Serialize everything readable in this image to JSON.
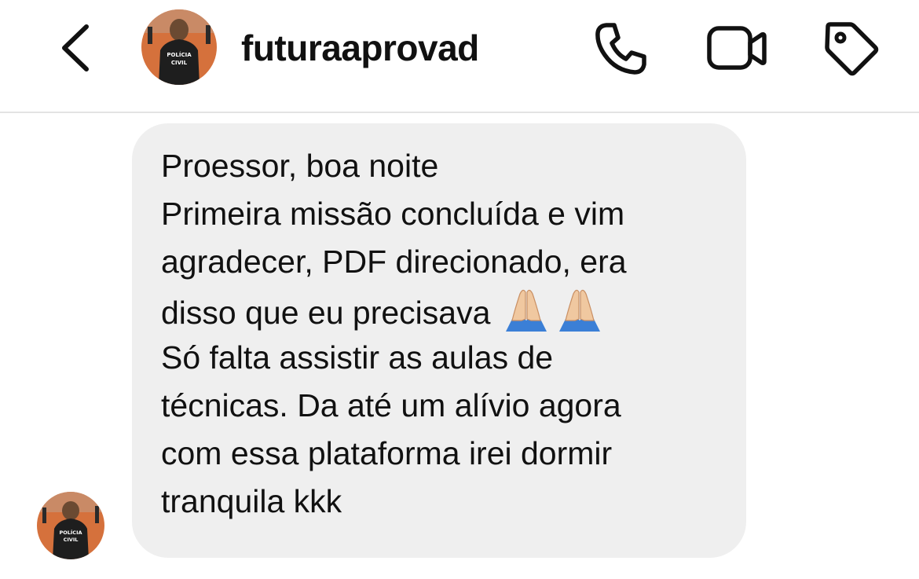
{
  "header": {
    "username": "futuraaprovad",
    "back_icon": "chevron-left-icon",
    "call_icon": "phone-icon",
    "video_icon": "video-camera-icon",
    "tag_icon": "tag-icon",
    "avatar_badge_line1": "POLÍCIA",
    "avatar_badge_line2": "CIVIL"
  },
  "message": {
    "lines": [
      "Proessor, boa noite",
      "Primeira missão concluída e vim",
      "agradecer, PDF direcionado, era",
      "disso que eu precisava",
      "Só falta assistir as aulas de",
      "técnicas. Da até um alívio agora",
      "com essa plataforma irei dormir",
      "tranquila kkk"
    ],
    "emoji_icons": [
      "folded-hands-emoji-icon",
      "folded-hands-emoji-icon"
    ],
    "bubble_color": "#efefef"
  },
  "sender_avatar": {
    "badge_line1": "POLÍCIA",
    "badge_line2": "CIVIL"
  }
}
